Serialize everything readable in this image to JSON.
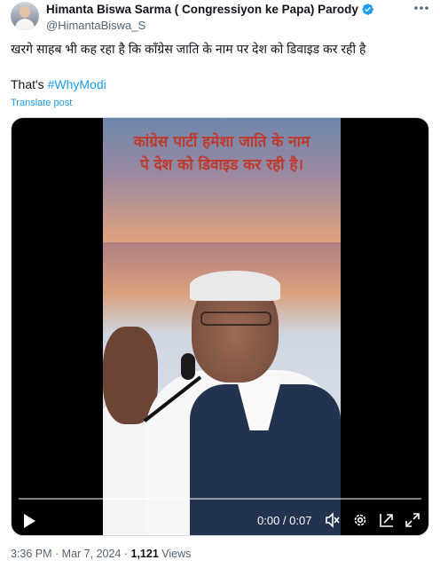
{
  "author": {
    "display_name": "Himanta Biswa Sarma ( Congressiyon ke Papa) Parody",
    "handle": "@HimantaBiswa_S",
    "verified_color": "#1d9bf0"
  },
  "post": {
    "text_line1": "खरगे साहब भी कह रहा है कि कॉंग्रेस जाति के नाम पर देश को डिवाइड कर रही है",
    "text_prefix": "That's ",
    "hashtag": "#WhyModi",
    "translate_label": "Translate post"
  },
  "video": {
    "overlay_line1": "कांग्रेस पार्टी हमेशा जाति के नाम",
    "overlay_line2": "पे देश को डिवाइड कर रही है।",
    "time_display": "0:00 / 0:07",
    "progress": 0
  },
  "footer": {
    "time": "3:36 PM",
    "separator": " · ",
    "date": "Mar 7, 2024",
    "views_count": "1,121",
    "views_label": " Views"
  },
  "icons": {
    "more": "more-icon",
    "play": "play-icon",
    "volume": "volume-icon",
    "settings": "settings-icon",
    "pip": "picture-in-picture-icon",
    "fullscreen": "fullscreen-icon"
  }
}
